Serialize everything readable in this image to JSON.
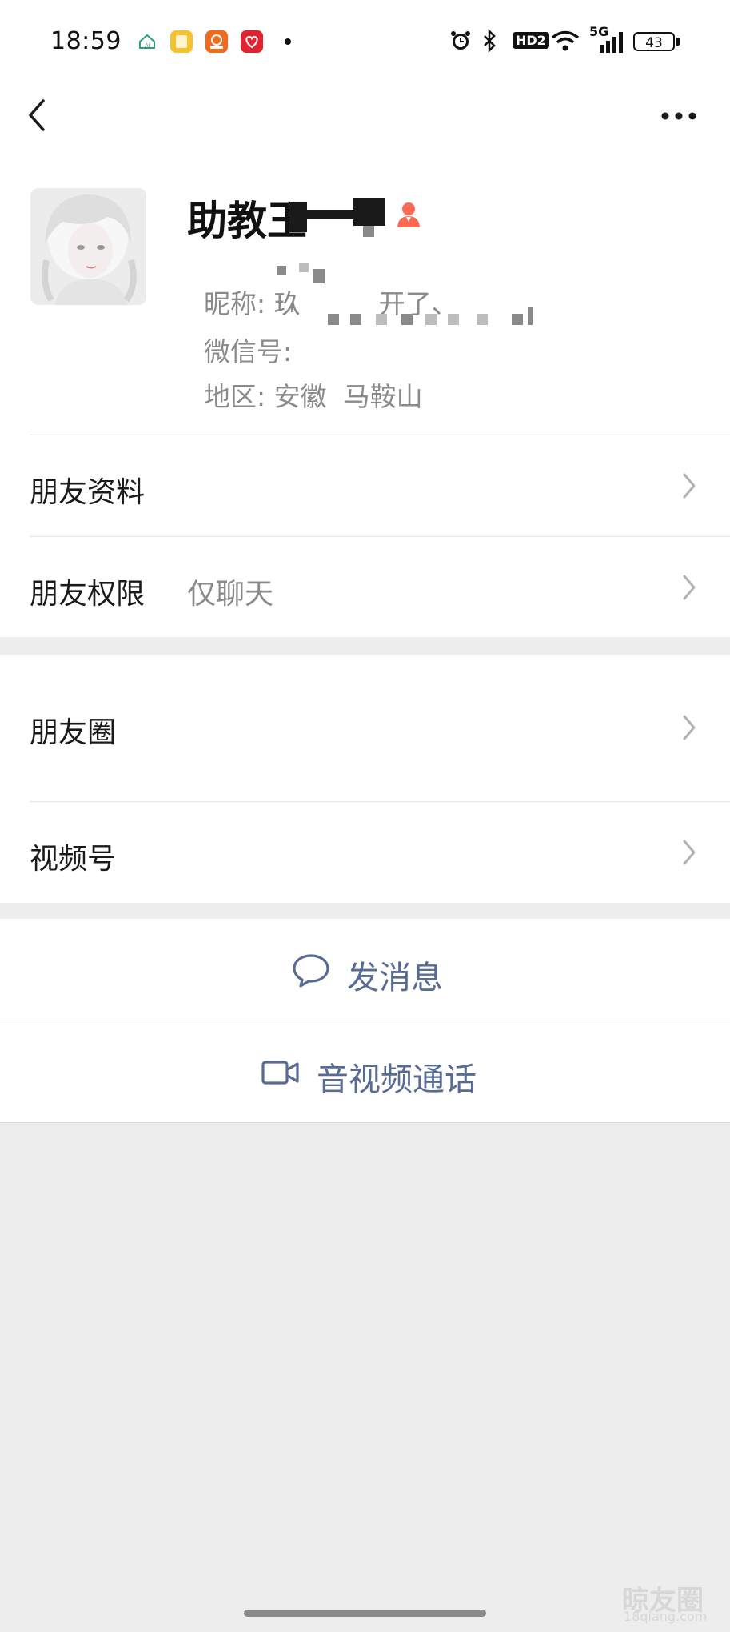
{
  "status_bar": {
    "time": "18:59",
    "network": "5G",
    "hd_label": "HD2",
    "battery": "43"
  },
  "header": {
    "back_icon": "chevron-left-icon",
    "more_icon": "more-dots-icon"
  },
  "profile": {
    "display_name": "助教王",
    "nickname_label": "昵称: ",
    "nickname_visible_start": "玖",
    "nickname_visible_end": "开了、",
    "wechat_id_label": "微信号: ",
    "region_label": "地区: ",
    "region_value": "安徽  马鞍山",
    "contact_icon": "person-icon"
  },
  "menu": {
    "friend_info": "朋友资料",
    "friend_permission": "朋友权限",
    "friend_permission_value": "仅聊天",
    "moments": "朋友圈",
    "channels": "视频号"
  },
  "actions": {
    "send_message": "发消息",
    "av_call": "音视频通话"
  },
  "watermark": {
    "main": "晾友圈",
    "sub": "18qiang.com"
  },
  "colors": {
    "link_blue": "#576b95",
    "background": "#ededed",
    "card": "#ffffff",
    "accent_contact": "#fa6a52"
  }
}
